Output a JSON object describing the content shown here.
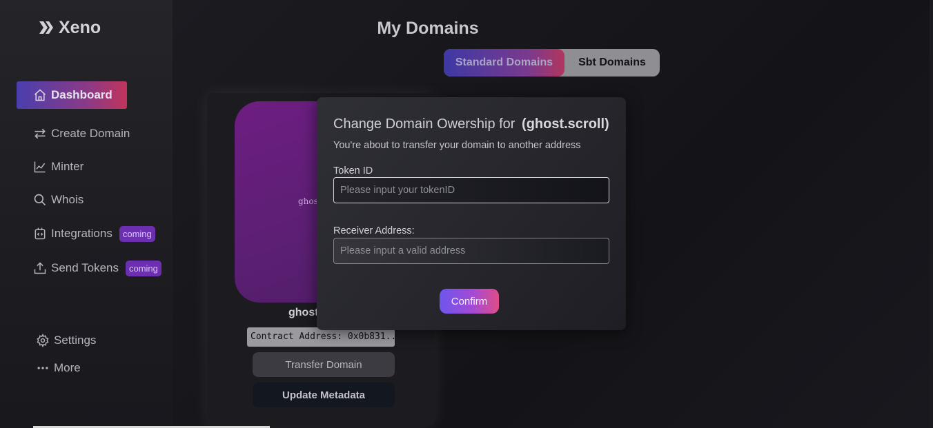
{
  "app": {
    "name": "Xeno"
  },
  "sidebar": {
    "items": [
      {
        "label": "Dashboard",
        "icon": "home-icon",
        "active": true
      },
      {
        "label": "Create Domain",
        "icon": "arrows-swap-icon"
      },
      {
        "label": "Minter",
        "icon": "chart-line-icon"
      },
      {
        "label": "Whois",
        "icon": "search-icon"
      },
      {
        "label": "Integrations",
        "icon": "code-box-icon",
        "badge": "coming"
      },
      {
        "label": "Send Tokens",
        "icon": "upload-icon",
        "badge": "coming"
      }
    ],
    "bottom": [
      {
        "label": "Settings",
        "icon": "gear-icon"
      },
      {
        "label": "More",
        "icon": "more-dots-icon"
      }
    ]
  },
  "page": {
    "title": "My Domains",
    "tabs": [
      {
        "label": "Standard Domains",
        "active": true
      },
      {
        "label": "Sbt Domains",
        "active": false
      }
    ]
  },
  "card": {
    "image_text": "ghos",
    "name": "ghost",
    "contract": "Contract Address: 0x0b831...",
    "transfer_label": "Transfer Domain",
    "update_label": "Update Metadata"
  },
  "modal": {
    "title": "Change Domain Owership for",
    "domain": "(ghost.scroll)",
    "subtitle": "You're about to transfer your domain to another address",
    "token_label": "Token ID",
    "token_placeholder": "Please input your tokenID",
    "receiver_label": "Receiver Address:",
    "receiver_placeholder": "Please input a valid address",
    "confirm_label": "Confirm"
  },
  "colors": {
    "accent_start": "#4a3fae",
    "accent_end": "#c0345c",
    "badge": "#6c2fb0",
    "card_image": "#6e1e82"
  }
}
